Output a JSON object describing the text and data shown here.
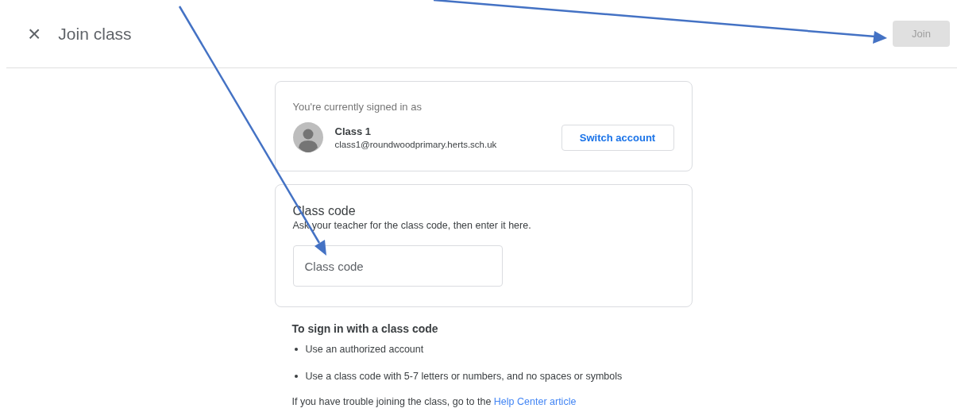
{
  "header": {
    "close_glyph": "×",
    "title": "Join class",
    "join_button": {
      "label": "Join",
      "disabled": true
    }
  },
  "account": {
    "caption": "You're currently signed in as",
    "name": "Class 1",
    "email": "class1@roundwoodprimary.herts.sch.uk",
    "switch_button": "Switch account"
  },
  "class_code": {
    "heading": "Class code",
    "hint": "Ask your teacher for the class code, then enter it here.",
    "placeholder": "Class code"
  },
  "help": {
    "heading": "To sign in with a class code",
    "bullets": [
      "Use an authorized account",
      "Use a class code with 5-7 letters or numbers, and no spaces or symbols"
    ],
    "footer": "If you have trouble joining the class, go to the",
    "link": "Help Center article"
  }
}
